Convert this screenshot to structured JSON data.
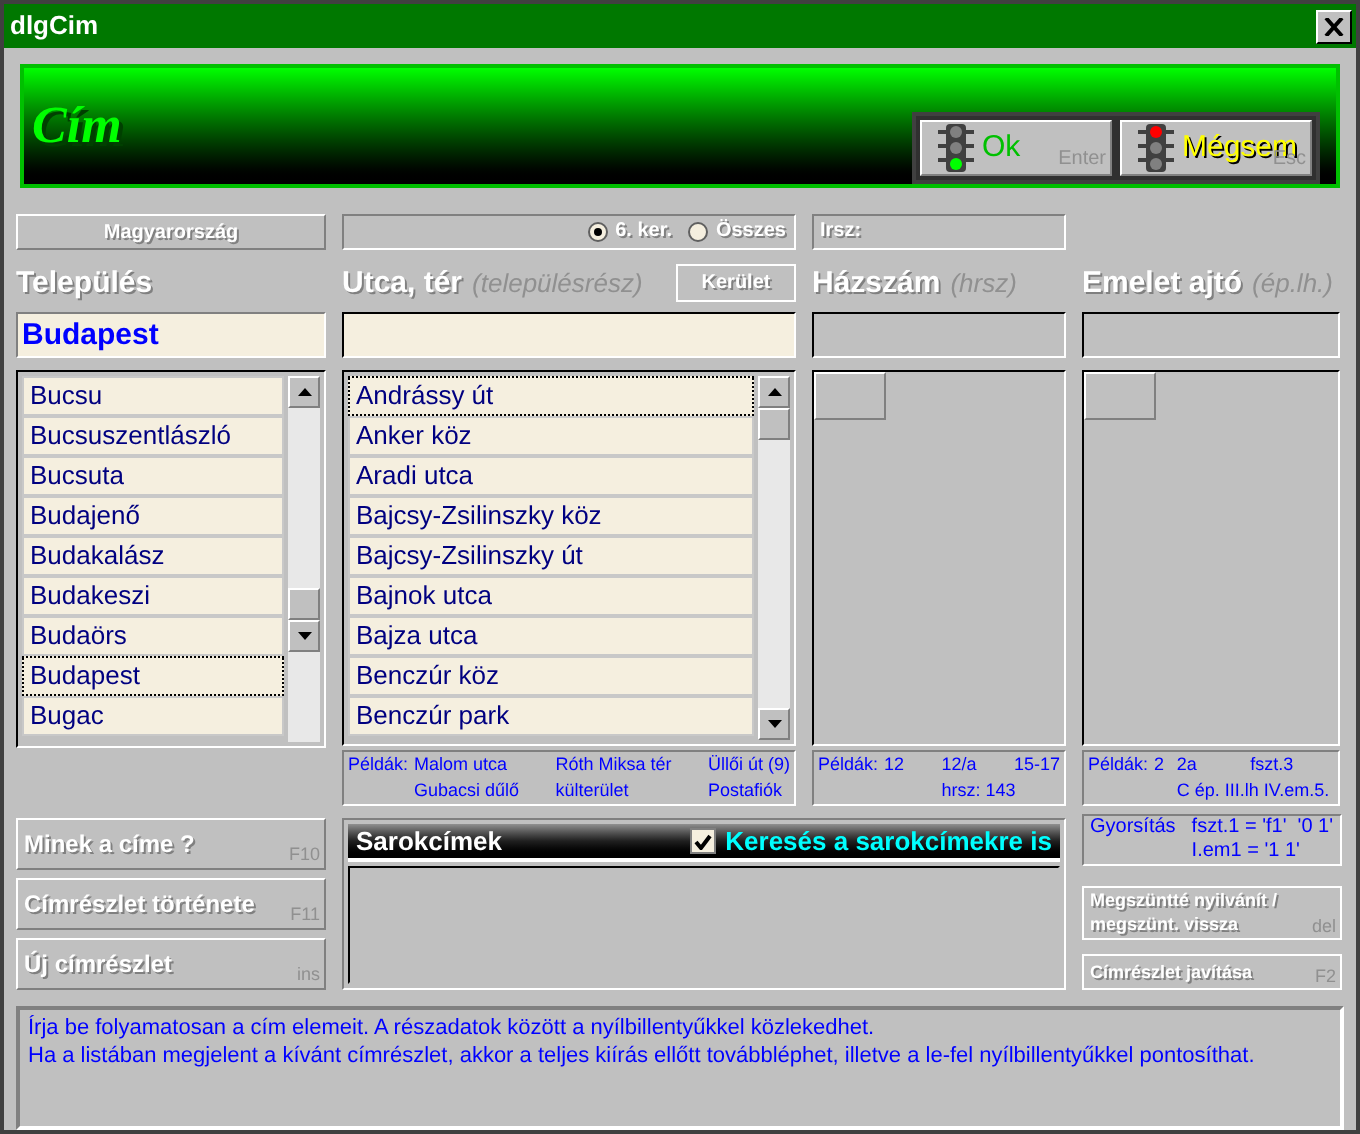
{
  "window": {
    "title": "dlgCim"
  },
  "header": {
    "title": "Cím",
    "buttons": [
      {
        "kind": "ok",
        "label": "Ok",
        "shortcut": "Enter"
      },
      {
        "kind": "cancel",
        "label": "Mégsem",
        "shortcut": "Esc"
      }
    ]
  },
  "country_button": "Magyarország",
  "district_radios": [
    {
      "label": "6. ker.",
      "selected": true
    },
    {
      "label": "Összes",
      "selected": false
    }
  ],
  "irsz_label": "Irsz:",
  "settlement": {
    "heading": "Település",
    "value": "Budapest",
    "items": [
      {
        "label": "Bucsu",
        "selected": false
      },
      {
        "label": "Bucsuszentlászló",
        "selected": false
      },
      {
        "label": "Bucsuta",
        "selected": false
      },
      {
        "label": "Budajenő",
        "selected": false
      },
      {
        "label": "Budakalász",
        "selected": false
      },
      {
        "label": "Budakeszi",
        "selected": false
      },
      {
        "label": "Budaörs",
        "selected": false
      },
      {
        "label": "Budapest",
        "selected": true
      },
      {
        "label": "Bugac",
        "selected": false
      }
    ]
  },
  "street": {
    "heading": "Utca, tér",
    "hint": "(településrész)",
    "button": "Kerület",
    "items": [
      {
        "label": "Andrássy út",
        "selected": true
      },
      {
        "label": "Anker köz",
        "selected": false
      },
      {
        "label": "Aradi utca",
        "selected": false
      },
      {
        "label": "Bajcsy-Zsilinszky köz",
        "selected": false
      },
      {
        "label": "Bajcsy-Zsilinszky út",
        "selected": false
      },
      {
        "label": "Bajnok utca",
        "selected": false
      },
      {
        "label": "Bajza utca",
        "selected": false
      },
      {
        "label": "Benczúr köz",
        "selected": false
      },
      {
        "label": "Benczúr park",
        "selected": false
      }
    ],
    "examples": {
      "label": "Példák:",
      "rows": [
        [
          "Malom utca",
          "Róth Miksa tér",
          "Üllői út (9)"
        ],
        [
          "Gubacsi dűlő",
          "külterület",
          "Postafiók"
        ]
      ]
    }
  },
  "house": {
    "heading": "Házszám",
    "hint": "(hrsz)",
    "examples": {
      "label": "Példák:",
      "rows": [
        [
          "12",
          "12/a",
          "15-17"
        ],
        [
          "",
          "hrsz: 143"
        ]
      ]
    }
  },
  "floor": {
    "heading": "Emelet ajtó",
    "hint": "(ép.lh.)",
    "examples": {
      "label": "Példák:",
      "rows": [
        [
          "2",
          "2a",
          "fszt.3"
        ],
        [
          "",
          "C ép. III.lh IV.em.5."
        ]
      ]
    },
    "speedup": {
      "label": "Gyorsítás",
      "rows": [
        "fszt.1 = 'f1'  '0 1'",
        "I.em1 = '1 1'"
      ]
    }
  },
  "left_buttons": [
    {
      "label": "Minek a címe ?",
      "shortcut": "F10"
    },
    {
      "label": "Címrészlet története",
      "shortcut": "F11"
    },
    {
      "label": "Új címrészlet",
      "shortcut": "ins"
    }
  ],
  "corner_addresses": {
    "title": "Sarokcímek",
    "checkbox": {
      "label": "Keresés a sarokcímekre is",
      "checked": true
    }
  },
  "right_buttons": [
    {
      "label": "Megszüntté nyilvánít / megszünt. vissza",
      "shortcut": "del"
    },
    {
      "label": "Címrészlet javítása",
      "shortcut": "F2"
    }
  ],
  "info": [
    "Írja be folyamatosan a cím elemeit. A részadatok között a nyílbillentyűkkel közlekedhet.",
    "Ha a listában megjelent a kívánt címrészlet, akkor a teljes kiírás ellőtt továbbléphet, illetve a le-fel nyílbillentyűkkel pontosíthat."
  ]
}
